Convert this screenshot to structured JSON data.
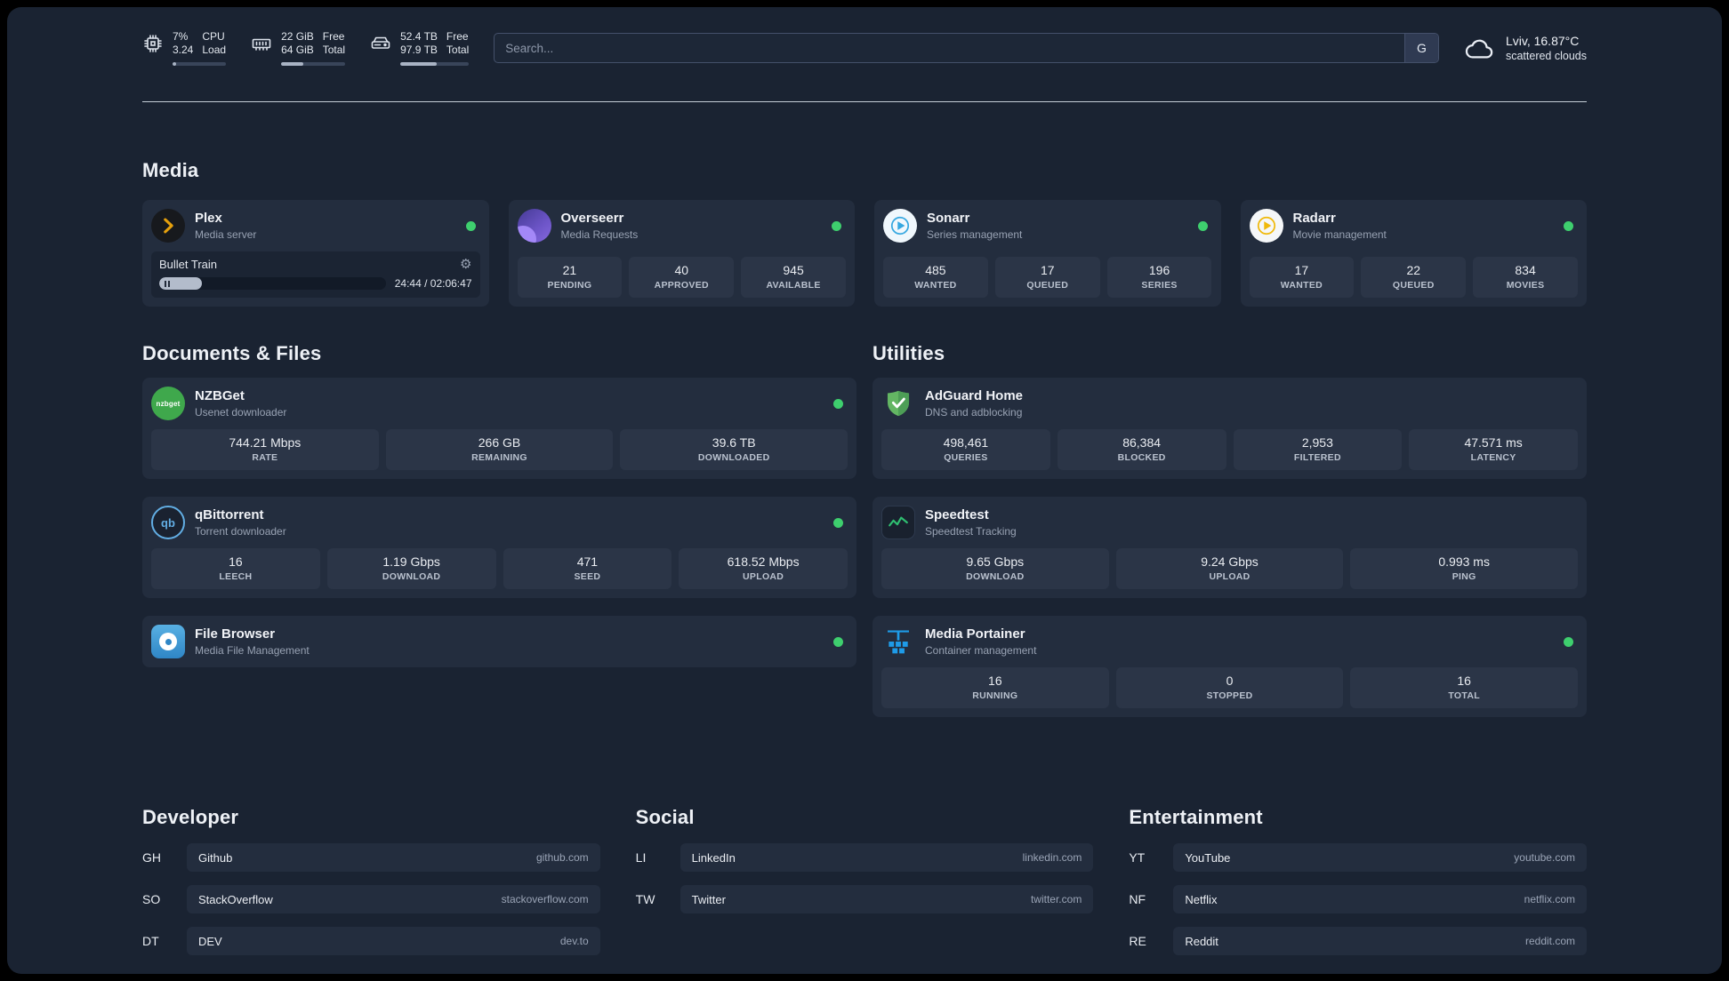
{
  "colors": {
    "status-online": "#3ecf6e",
    "plex": "#e5a00d",
    "sonarr": "#35a7e0",
    "radarr": "#f0b90b",
    "nzbget": "#3fa84c",
    "qbittorrent": "#62aee4",
    "adguard": "#5bb85d",
    "speedtest": "#2fbf71",
    "portainer": "#1e9be8"
  },
  "topbar": {
    "cpu": {
      "value_top": "7%",
      "value_bottom": "3.24",
      "label_top": "CPU",
      "label_bottom": "Load",
      "progress": "7%"
    },
    "ram": {
      "value_top": "22 GiB",
      "value_bottom": "64 GiB",
      "label_top": "Free",
      "label_bottom": "Total",
      "progress": "34%"
    },
    "disk": {
      "value_top": "52.4 TB",
      "value_bottom": "97.9 TB",
      "label_top": "Free",
      "label_bottom": "Total",
      "progress": "53%"
    },
    "search": {
      "placeholder": "Search...",
      "engine_label": "G"
    },
    "weather": {
      "location": "Lviv, 16.87°C",
      "condition": "scattered clouds"
    }
  },
  "sections": {
    "media": "Media",
    "documents": "Documents & Files",
    "utilities": "Utilities",
    "developer": "Developer",
    "social": "Social",
    "entertainment": "Entertainment"
  },
  "media": {
    "plex": {
      "name": "Plex",
      "subtitle": "Media server",
      "now_playing": "Bullet Train",
      "time": "24:44 / 02:06:47",
      "progress": "19%"
    },
    "overseerr": {
      "name": "Overseerr",
      "subtitle": "Media Requests",
      "stats": [
        {
          "value": "21",
          "label": "PENDING"
        },
        {
          "value": "40",
          "label": "APPROVED"
        },
        {
          "value": "945",
          "label": "AVAILABLE"
        }
      ]
    },
    "sonarr": {
      "name": "Sonarr",
      "subtitle": "Series management",
      "stats": [
        {
          "value": "485",
          "label": "WANTED"
        },
        {
          "value": "17",
          "label": "QUEUED"
        },
        {
          "value": "196",
          "label": "SERIES"
        }
      ]
    },
    "radarr": {
      "name": "Radarr",
      "subtitle": "Movie management",
      "stats": [
        {
          "value": "17",
          "label": "WANTED"
        },
        {
          "value": "22",
          "label": "QUEUED"
        },
        {
          "value": "834",
          "label": "MOVIES"
        }
      ]
    }
  },
  "documents": {
    "nzbget": {
      "name": "NZBGet",
      "subtitle": "Usenet downloader",
      "icon_text": "nzbget",
      "stats": [
        {
          "value": "744.21 Mbps",
          "label": "RATE"
        },
        {
          "value": "266 GB",
          "label": "REMAINING"
        },
        {
          "value": "39.6 TB",
          "label": "DOWNLOADED"
        }
      ]
    },
    "qbittorrent": {
      "name": "qBittorrent",
      "subtitle": "Torrent downloader",
      "icon_text": "qb",
      "stats": [
        {
          "value": "16",
          "label": "LEECH"
        },
        {
          "value": "1.19 Gbps",
          "label": "DOWNLOAD"
        },
        {
          "value": "471",
          "label": "SEED"
        },
        {
          "value": "618.52 Mbps",
          "label": "UPLOAD"
        }
      ]
    },
    "filebrowser": {
      "name": "File Browser",
      "subtitle": "Media File Management"
    }
  },
  "utilities": {
    "adguard": {
      "name": "AdGuard Home",
      "subtitle": "DNS and adblocking",
      "stats": [
        {
          "value": "498,461",
          "label": "QUERIES"
        },
        {
          "value": "86,384",
          "label": "BLOCKED"
        },
        {
          "value": "2,953",
          "label": "FILTERED"
        },
        {
          "value": "47.571 ms",
          "label": "LATENCY"
        }
      ]
    },
    "speedtest": {
      "name": "Speedtest",
      "subtitle": "Speedtest Tracking",
      "stats": [
        {
          "value": "9.65 Gbps",
          "label": "DOWNLOAD"
        },
        {
          "value": "9.24 Gbps",
          "label": "UPLOAD"
        },
        {
          "value": "0.993 ms",
          "label": "PING"
        }
      ]
    },
    "portainer": {
      "name": "Media Portainer",
      "subtitle": "Container management",
      "stats": [
        {
          "value": "16",
          "label": "RUNNING"
        },
        {
          "value": "0",
          "label": "STOPPED"
        },
        {
          "value": "16",
          "label": "TOTAL"
        }
      ]
    }
  },
  "bookmarks": {
    "developer": [
      {
        "abbr": "GH",
        "name": "Github",
        "url": "github.com"
      },
      {
        "abbr": "SO",
        "name": "StackOverflow",
        "url": "stackoverflow.com"
      },
      {
        "abbr": "DT",
        "name": "DEV",
        "url": "dev.to"
      }
    ],
    "social": [
      {
        "abbr": "LI",
        "name": "LinkedIn",
        "url": "linkedin.com"
      },
      {
        "abbr": "TW",
        "name": "Twitter",
        "url": "twitter.com"
      }
    ],
    "entertainment": [
      {
        "abbr": "YT",
        "name": "YouTube",
        "url": "youtube.com"
      },
      {
        "abbr": "NF",
        "name": "Netflix",
        "url": "netflix.com"
      },
      {
        "abbr": "RE",
        "name": "Reddit",
        "url": "reddit.com"
      }
    ]
  }
}
